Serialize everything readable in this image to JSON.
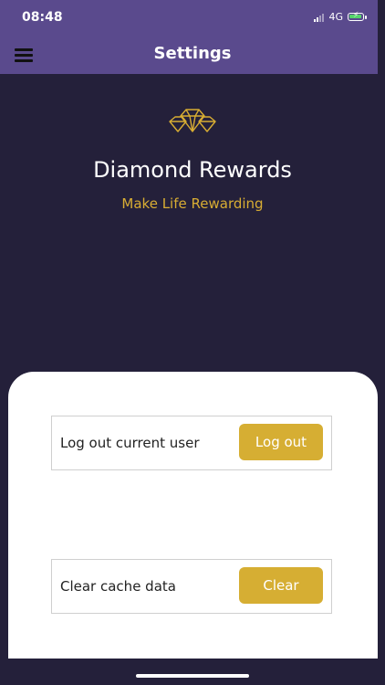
{
  "status_bar": {
    "time": "08:48",
    "network": "4G",
    "icons": [
      "signal-icon",
      "battery-charging-icon"
    ]
  },
  "header": {
    "title": "Settings",
    "menu_icon": "hamburger-menu-icon",
    "background": "#5a4a8d"
  },
  "brand": {
    "logo_icon": "diamond-icon",
    "title": "Diamond Rewards",
    "tagline": "Make Life Rewarding",
    "accent_color": "#d6ae33"
  },
  "settings": {
    "logout": {
      "label": "Log out current user",
      "button": "Log out"
    },
    "cache": {
      "label": "Clear cache data",
      "button": "Clear"
    }
  },
  "colors": {
    "background": "#24203a",
    "panel": "#ffffff"
  }
}
